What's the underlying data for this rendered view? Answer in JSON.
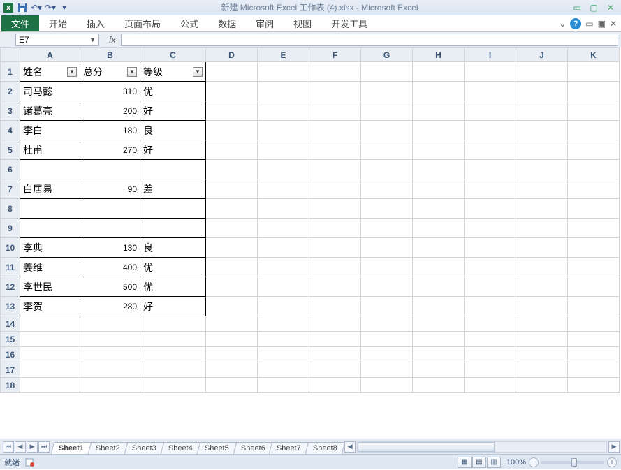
{
  "title": "新建 Microsoft Excel 工作表 (4).xlsx  -  Microsoft Excel",
  "ribbon": {
    "file": "文件",
    "tabs": [
      "开始",
      "插入",
      "页面布局",
      "公式",
      "数据",
      "审阅",
      "视图",
      "开发工具"
    ]
  },
  "namebox": {
    "cell_ref": "E7",
    "fx_label": "fx"
  },
  "columns": [
    "A",
    "B",
    "C",
    "D",
    "E",
    "F",
    "G",
    "H",
    "I",
    "J",
    "K"
  ],
  "row_numbers": [
    "1",
    "2",
    "3",
    "4",
    "5",
    "6",
    "7",
    "8",
    "9",
    "10",
    "11",
    "12",
    "13",
    "14",
    "15",
    "16",
    "17",
    "18"
  ],
  "headers": {
    "name": "姓名",
    "score": "总分",
    "grade": "等级"
  },
  "rows": [
    {
      "a": "司马懿",
      "b": "310",
      "c": "优"
    },
    {
      "a": "诸葛亮",
      "b": "200",
      "c": "好"
    },
    {
      "a": "李白",
      "b": "180",
      "c": "良"
    },
    {
      "a": "杜甫",
      "b": "270",
      "c": "好"
    },
    {
      "a": "",
      "b": "",
      "c": ""
    },
    {
      "a": "白居易",
      "b": "90",
      "c": "差"
    },
    {
      "a": "",
      "b": "",
      "c": ""
    },
    {
      "a": "",
      "b": "",
      "c": ""
    },
    {
      "a": "李典",
      "b": "130",
      "c": "良"
    },
    {
      "a": "姜维",
      "b": "400",
      "c": "优"
    },
    {
      "a": "李世民",
      "b": "500",
      "c": "优"
    },
    {
      "a": "李贺",
      "b": "280",
      "c": "好"
    }
  ],
  "sheets": [
    "Sheet1",
    "Sheet2",
    "Sheet3",
    "Sheet4",
    "Sheet5",
    "Sheet6",
    "Sheet7",
    "Sheet8"
  ],
  "active_sheet": 0,
  "status": {
    "ready": "就绪",
    "zoom": "100%"
  }
}
